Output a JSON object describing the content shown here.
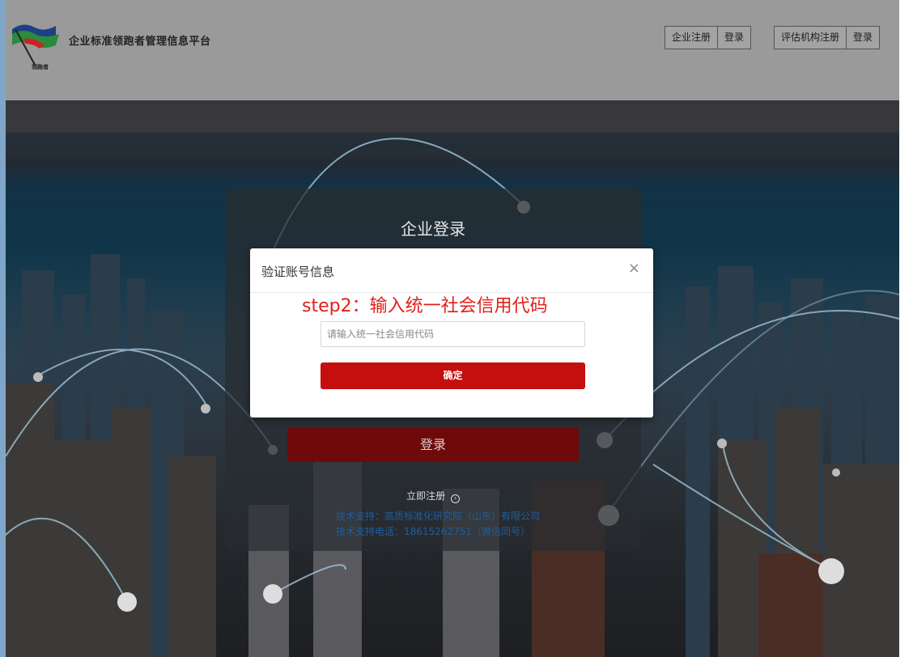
{
  "header": {
    "site_title": "企业标准领跑者管理信息平台",
    "logo_caption": "领跑者",
    "nav_group_enterprise": [
      {
        "label": "企业注册"
      },
      {
        "label": "登录"
      }
    ],
    "nav_group_agency": [
      {
        "label": "评估机构注册"
      },
      {
        "label": "登录"
      }
    ]
  },
  "login_panel": {
    "title": "企业登录",
    "login_button": "登录",
    "register_link": "立即注册",
    "support_line1": "技术支持：高质标准化研究院（山东）有限公司",
    "support_line2": "技术支持电话：18615262751（微信同号）"
  },
  "modal": {
    "title": "验证账号信息",
    "close_glyph": "×",
    "step_note": "step2：输入统一社会信用代码",
    "input_placeholder": "请输入统一社会信用代码",
    "input_value": "",
    "confirm_button": "确定"
  },
  "icons": {
    "logo": "flag-logo-icon",
    "register_arrow": "arrow-circle-right-icon",
    "close": "close-icon"
  },
  "colors": {
    "header_bg": "#9a9a9a",
    "confirm_red": "#c50f0f",
    "step_red": "#e0201a",
    "support_blue": "#1f5e9f"
  }
}
